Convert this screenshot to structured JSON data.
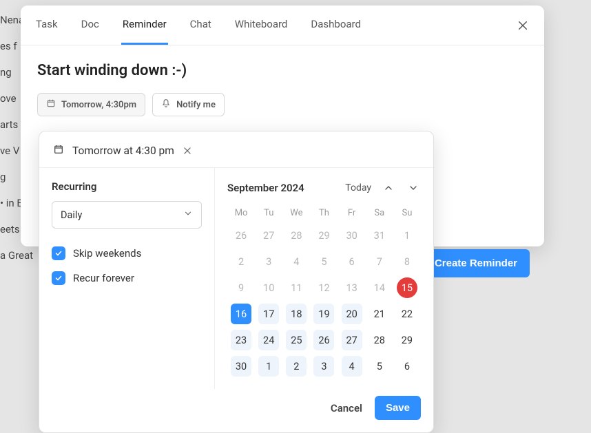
{
  "backdrop_lines": [
    "Nena",
    "es f",
    "ng",
    "ove",
    "arts",
    "ve V",
    "",
    "g",
    "• in Blo",
    "eets For",
    "a Great"
  ],
  "tabs": [
    "Task",
    "Doc",
    "Reminder",
    "Chat",
    "Whiteboard",
    "Dashboard"
  ],
  "active_tab_index": 2,
  "reminder": {
    "title": "Start winding down :-)",
    "date_chip": "Tomorrow, 4:30pm",
    "notify_chip": "Notify me",
    "create_button": "Create Reminder"
  },
  "popover": {
    "summary": "Tomorrow at 4:30 pm",
    "recurring": {
      "label": "Recurring",
      "frequency": "Daily",
      "skip_weekends": {
        "label": "Skip weekends",
        "checked": true
      },
      "recur_forever": {
        "label": "Recur forever",
        "checked": true
      }
    },
    "calendar": {
      "month_label": "September 2024",
      "today_label": "Today",
      "dow": [
        "Mo",
        "Tu",
        "We",
        "Th",
        "Fr",
        "Sa",
        "Su"
      ],
      "cells": [
        {
          "d": 26,
          "state": "other"
        },
        {
          "d": 27,
          "state": "other"
        },
        {
          "d": 28,
          "state": "other"
        },
        {
          "d": 29,
          "state": "other"
        },
        {
          "d": 30,
          "state": "other"
        },
        {
          "d": 31,
          "state": "other"
        },
        {
          "d": 1,
          "state": "other"
        },
        {
          "d": 2,
          "state": "other"
        },
        {
          "d": 3,
          "state": "other"
        },
        {
          "d": 4,
          "state": "other"
        },
        {
          "d": 5,
          "state": "other"
        },
        {
          "d": 6,
          "state": "other"
        },
        {
          "d": 7,
          "state": "other"
        },
        {
          "d": 8,
          "state": "other"
        },
        {
          "d": 9,
          "state": "other"
        },
        {
          "d": 10,
          "state": "other"
        },
        {
          "d": 11,
          "state": "other"
        },
        {
          "d": 12,
          "state": "other"
        },
        {
          "d": 13,
          "state": "other"
        },
        {
          "d": 14,
          "state": "other"
        },
        {
          "d": 15,
          "state": "today"
        },
        {
          "d": 16,
          "state": "selected"
        },
        {
          "d": 17,
          "state": "range"
        },
        {
          "d": 18,
          "state": "range"
        },
        {
          "d": 19,
          "state": "range"
        },
        {
          "d": 20,
          "state": "range"
        },
        {
          "d": 21,
          "state": ""
        },
        {
          "d": 22,
          "state": ""
        },
        {
          "d": 23,
          "state": "range"
        },
        {
          "d": 24,
          "state": "range"
        },
        {
          "d": 25,
          "state": "range"
        },
        {
          "d": 26,
          "state": "range"
        },
        {
          "d": 27,
          "state": "range"
        },
        {
          "d": 28,
          "state": ""
        },
        {
          "d": 29,
          "state": ""
        },
        {
          "d": 30,
          "state": "range"
        },
        {
          "d": 1,
          "state": "range"
        },
        {
          "d": 2,
          "state": "range"
        },
        {
          "d": 3,
          "state": "range"
        },
        {
          "d": 4,
          "state": "range"
        },
        {
          "d": 5,
          "state": ""
        },
        {
          "d": 6,
          "state": ""
        }
      ]
    },
    "cancel": "Cancel",
    "save": "Save"
  }
}
